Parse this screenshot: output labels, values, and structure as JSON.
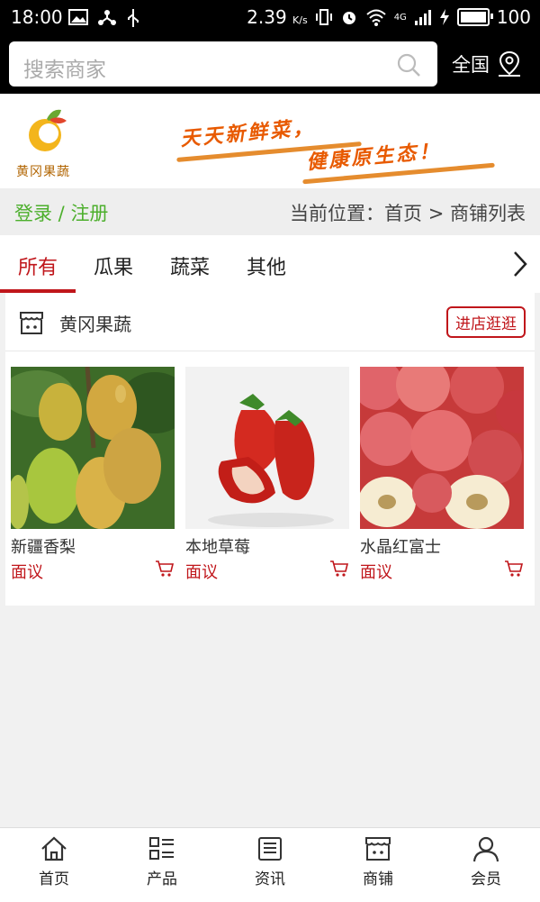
{
  "status_bar": {
    "time": "18:00",
    "speed": "2.39",
    "speed_unit": "K/s",
    "network": "4G",
    "battery": "100"
  },
  "search": {
    "placeholder": "搜索商家",
    "region_label": "全国"
  },
  "banner": {
    "logo_text": "黄冈果蔬",
    "slogan_line1": "天天新鲜菜，",
    "slogan_line2": "健康原生态！"
  },
  "breadcrumb": {
    "login": "登录",
    "separator": " / ",
    "register": "注册",
    "prefix": "当前位置：",
    "home": "首页",
    "arrow": " > ",
    "current": "商铺列表"
  },
  "tabs": [
    {
      "label": "所有"
    },
    {
      "label": "瓜果"
    },
    {
      "label": "蔬菜"
    },
    {
      "label": "其他"
    }
  ],
  "shop": {
    "name": "黄冈果蔬",
    "visit_label": "进店逛逛",
    "products": [
      {
        "name": "新疆香梨",
        "price": "面议"
      },
      {
        "name": "本地草莓",
        "price": "面议"
      },
      {
        "name": "水晶红富士",
        "price": "面议"
      }
    ]
  },
  "bottom_nav": [
    {
      "label": "首页"
    },
    {
      "label": "产品"
    },
    {
      "label": "资讯"
    },
    {
      "label": "商铺"
    },
    {
      "label": "会员"
    }
  ],
  "colors": {
    "accent": "#c0161b",
    "green": "#4caf2c",
    "orange": "#e85a00"
  }
}
